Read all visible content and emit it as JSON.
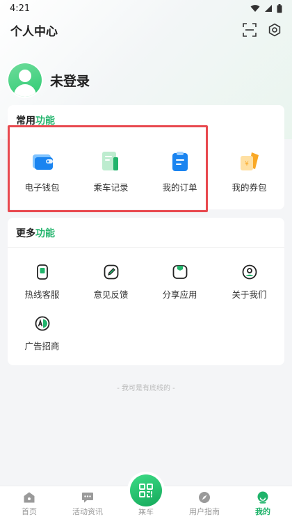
{
  "status_bar": {
    "time": "4:21"
  },
  "header": {
    "title": "个人中心",
    "scan_icon": "scan-icon",
    "settings_icon": "settings-icon"
  },
  "profile": {
    "name": "未登录"
  },
  "common": {
    "title_plain": "常用",
    "title_accent": "功能",
    "items": [
      {
        "label": "电子钱包",
        "icon": "wallet-icon"
      },
      {
        "label": "乘车记录",
        "icon": "ride-record-icon"
      },
      {
        "label": "我的订单",
        "icon": "order-icon"
      },
      {
        "label": "我的券包",
        "icon": "coupon-icon"
      }
    ]
  },
  "more": {
    "title_plain": "更多",
    "title_accent": "功能",
    "items": [
      {
        "label": "热线客服",
        "icon": "phone-icon"
      },
      {
        "label": "意见反馈",
        "icon": "feedback-icon"
      },
      {
        "label": "分享应用",
        "icon": "share-icon"
      },
      {
        "label": "关于我们",
        "icon": "about-icon"
      },
      {
        "label": "广告招商",
        "icon": "ad-icon"
      }
    ]
  },
  "footer_note": "- 我可是有底线的 -",
  "tabbar": {
    "tabs": [
      {
        "label": "首页",
        "icon": "home-icon"
      },
      {
        "label": "活动资讯",
        "icon": "message-icon"
      },
      {
        "label": "乘车",
        "icon": "qr-code-icon"
      },
      {
        "label": "用户指南",
        "icon": "compass-icon"
      },
      {
        "label": "我的",
        "icon": "user-icon"
      }
    ],
    "active": "我的"
  },
  "colors": {
    "accent": "#22b46c",
    "highlight": "#e8494f"
  }
}
